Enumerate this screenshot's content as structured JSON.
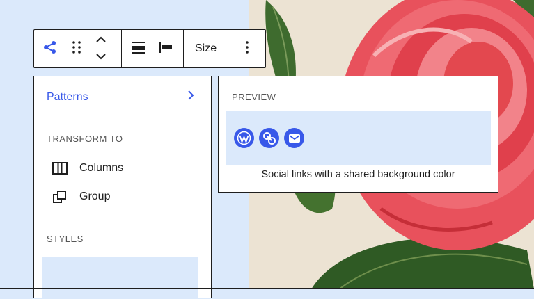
{
  "toolbar": {
    "size_label": "Size"
  },
  "menu": {
    "patterns_label": "Patterns",
    "transform_title": "TRANSFORM TO",
    "transform_items": [
      {
        "label": "Columns",
        "icon": "columns-icon"
      },
      {
        "label": "Group",
        "icon": "group-icon"
      }
    ],
    "styles_title": "STYLES"
  },
  "preview": {
    "title": "PREVIEW",
    "icons": [
      "wordpress-icon",
      "link-icon",
      "mail-icon"
    ],
    "caption": "Social links with a shared background color"
  },
  "colors": {
    "accent": "#3858e9",
    "canvas": "#dbe9fb",
    "border": "#1e1e1e"
  }
}
